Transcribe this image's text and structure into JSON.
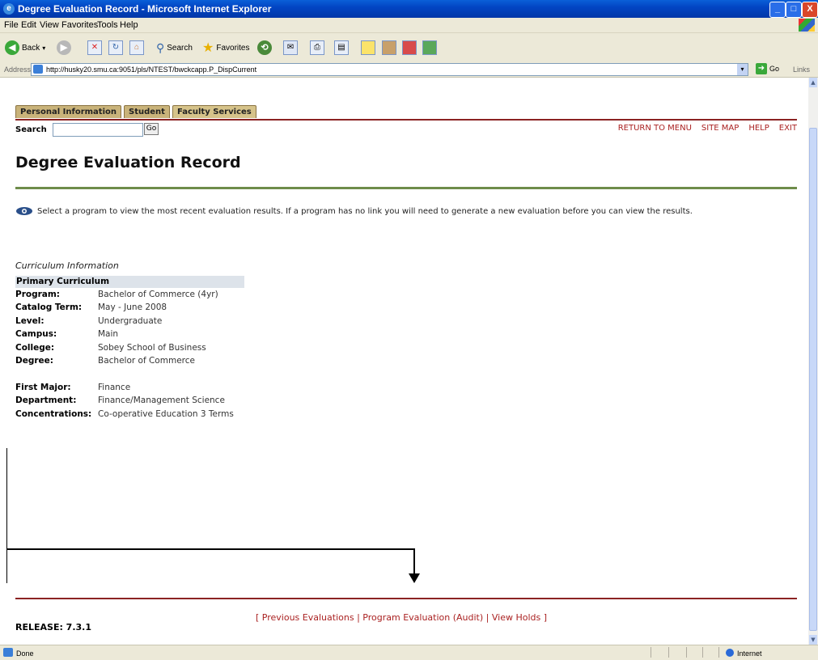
{
  "window": {
    "title": "Degree Evaluation Record - Microsoft Internet Explorer",
    "min": "_",
    "max": "□",
    "close": "X"
  },
  "menu": [
    "File",
    "Edit",
    "View",
    "Favorites",
    "Tools",
    "Help"
  ],
  "toolbar": {
    "back": "Back",
    "search": "Search",
    "favorites": "Favorites"
  },
  "address": {
    "label": "Address",
    "url": "http://husky20.smu.ca:9051/pls/NTEST/bwckcapp.P_DispCurrent",
    "go": "Go",
    "links": "Links"
  },
  "tabs": [
    "Personal Information",
    "Student",
    "Faculty Services"
  ],
  "search": {
    "label": "Search",
    "go": "Go",
    "value": ""
  },
  "top_links": [
    "RETURN TO MENU",
    "SITE MAP",
    "HELP",
    "EXIT"
  ],
  "page_title": "Degree Evaluation Record",
  "info_text": "Select a program to view the most recent evaluation results. If a program has no link you will need to generate a new evaluation before you can view the results.",
  "curriculum": {
    "section_title": "Curriculum Information",
    "header": "Primary Curriculum",
    "rows": [
      {
        "k": "Program:",
        "v": "Bachelor of Commerce (4yr)"
      },
      {
        "k": "Catalog Term:",
        "v": "May - June 2008"
      },
      {
        "k": "Level:",
        "v": "Undergraduate"
      },
      {
        "k": "Campus:",
        "v": "Main"
      },
      {
        "k": "College:",
        "v": "Sobey School of Business"
      },
      {
        "k": "Degree:",
        "v": "Bachelor of Commerce"
      }
    ],
    "rows2": [
      {
        "k": "First Major:",
        "v": "Finance"
      },
      {
        "k": "Department:",
        "v": "Finance/Management Science"
      },
      {
        "k": "Concentrations:",
        "v": "Co-operative Education 3 Terms"
      }
    ]
  },
  "bottom_links": {
    "open": "[",
    "items": [
      "Previous Evaluations",
      "Program Evaluation (Audit)",
      "View Holds"
    ],
    "sep": "|",
    "close": "]"
  },
  "release": "RELEASE: 7.3.1",
  "status": {
    "text": "Done",
    "zone": "Internet"
  },
  "colors": {
    "accent_red": "#8b2323",
    "tab_tan": "#c9b37a",
    "rule_green": "#6e8c4a",
    "link_red": "#aa2222"
  }
}
